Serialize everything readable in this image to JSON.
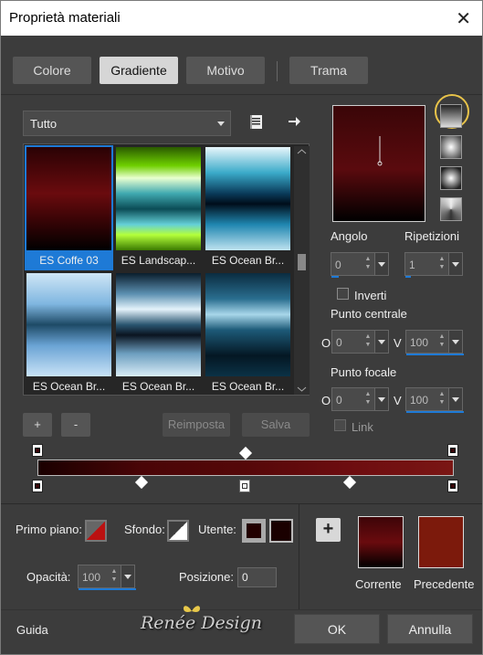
{
  "window": {
    "title": "Proprietà materiali"
  },
  "tabs": [
    "Colore",
    "Gradiente",
    "Motivo",
    "Trama"
  ],
  "category": {
    "value": "Tutto"
  },
  "gradients": [
    {
      "name": "ES Coffe 03",
      "selected": true
    },
    {
      "name": "ES Landscap..."
    },
    {
      "name": "ES Ocean Br..."
    },
    {
      "name": "ES Ocean Br..."
    },
    {
      "name": "ES Ocean Br..."
    },
    {
      "name": "ES Ocean Br..."
    }
  ],
  "buttons": {
    "add": "+",
    "remove": "-",
    "reset": "Reimposta",
    "save": "Salva"
  },
  "angle": {
    "label": "Angolo",
    "value": "0"
  },
  "repeats": {
    "label": "Ripetizioni",
    "value": "1"
  },
  "invert": {
    "label": "Inverti",
    "checked": false
  },
  "center": {
    "label": "Punto centrale",
    "o_label": "O",
    "o": "0",
    "v_label": "V",
    "v": "100"
  },
  "focal": {
    "label": "Punto focale",
    "o_label": "O",
    "o": "0",
    "v_label": "V",
    "v": "100"
  },
  "link": {
    "label": "Link",
    "checked": false
  },
  "bottom": {
    "foreground": "Primo piano:",
    "background": "Sfondo:",
    "user": "Utente:",
    "opacity": "Opacità:",
    "opacity_value": "100",
    "position": "Posizione:",
    "position_value": "0",
    "current": "Corrente",
    "previous": "Precedente",
    "current_color": "#3d0508",
    "previous_color": "#7c1a0c"
  },
  "watermark": "Renée Design",
  "footer": {
    "help": "Guida",
    "ok": "OK",
    "cancel": "Annulla"
  }
}
